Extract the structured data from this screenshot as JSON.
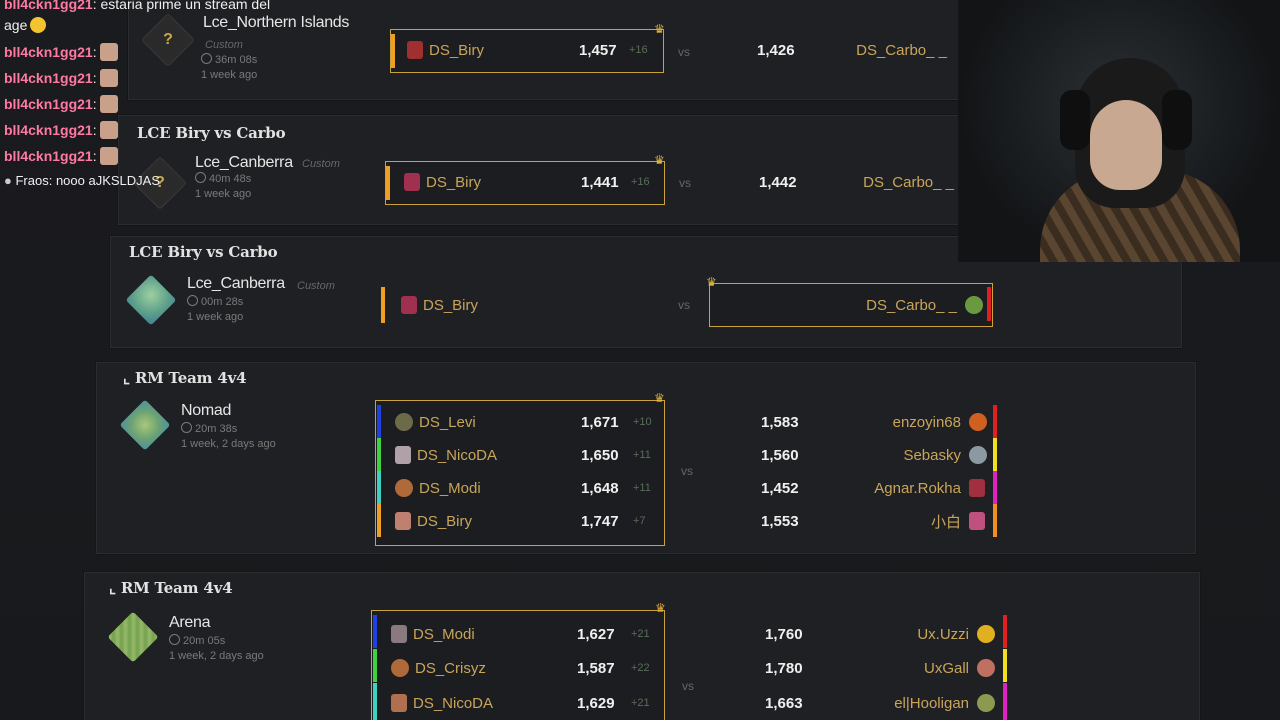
{
  "chat": [
    {
      "user": "bll4ckn1gg21",
      "text": "estaria prime un stream del"
    },
    {
      "user": "",
      "text": "age"
    },
    {
      "user": "bll4ckn1gg21",
      "text": ""
    },
    {
      "user": "bll4ckn1gg21",
      "text": ""
    },
    {
      "user": "bll4ckn1gg21",
      "text": ""
    },
    {
      "user": "bll4ckn1gg21",
      "text": ""
    },
    {
      "user": "bll4ckn1gg21",
      "text": ""
    },
    {
      "user": "Fraos",
      "text": "nooo aJKSLDJAS"
    }
  ],
  "vs_label": "vs",
  "matches": [
    {
      "title": "",
      "map": "Lce_Northern Islands",
      "tag": "Custom",
      "duration": "36m 08s",
      "ago": "1 week ago",
      "left": [
        {
          "name": "DS_Biry",
          "rating": "1,457",
          "delta": "+16"
        }
      ],
      "right": [
        {
          "name": "DS_Carbo_ _",
          "rating": "1,426"
        }
      ]
    },
    {
      "title": "LCE Biry vs Carbo",
      "map": "Lce_Canberra",
      "tag": "Custom",
      "duration": "40m 48s",
      "ago": "1 week ago",
      "left": [
        {
          "name": "DS_Biry",
          "rating": "1,441",
          "delta": "+16"
        }
      ],
      "right": [
        {
          "name": "DS_Carbo_ _",
          "rating": "1,442"
        }
      ]
    },
    {
      "title": "LCE Biry vs Carbo",
      "map": "Lce_Canberra",
      "tag": "Custom",
      "duration": "00m 28s",
      "ago": "1 week ago",
      "left": [
        {
          "name": "DS_Biry"
        }
      ],
      "right": [
        {
          "name": "DS_Carbo_ _"
        }
      ]
    },
    {
      "title": "RM Team 4v4",
      "map": "Nomad",
      "tag": "",
      "duration": "20m 38s",
      "ago": "1 week, 2 days ago",
      "left": [
        {
          "name": "DS_Levi",
          "rating": "1,671",
          "delta": "+10"
        },
        {
          "name": "DS_NicoDA",
          "rating": "1,650",
          "delta": "+11"
        },
        {
          "name": "DS_Modi",
          "rating": "1,648",
          "delta": "+11"
        },
        {
          "name": "DS_Biry",
          "rating": "1,747",
          "delta": "+7"
        }
      ],
      "right": [
        {
          "name": "enzoyin68",
          "rating": "1,583"
        },
        {
          "name": "Sebasky",
          "rating": "1,560"
        },
        {
          "name": "Agnar.Rokha",
          "rating": "1,452"
        },
        {
          "name": "小白",
          "rating": "1,553"
        }
      ]
    },
    {
      "title": "RM Team 4v4",
      "map": "Arena",
      "tag": "",
      "duration": "20m 05s",
      "ago": "1 week, 2 days ago",
      "left": [
        {
          "name": "DS_Modi",
          "rating": "1,627",
          "delta": "+21"
        },
        {
          "name": "DS_Crisyz",
          "rating": "1,587",
          "delta": "+22"
        },
        {
          "name": "DS_NicoDA",
          "rating": "1,629",
          "delta": "+21"
        }
      ],
      "right": [
        {
          "name": "Ux.Uzzi",
          "rating": "1,760"
        },
        {
          "name": "UxGall",
          "rating": "1,780"
        },
        {
          "name": "el|Hooligan",
          "rating": "1,663"
        }
      ]
    }
  ],
  "colors": {
    "accent_gold": "#c9a23e",
    "player_name": "#c9a55a",
    "chat_user": "#ff7aa2"
  }
}
